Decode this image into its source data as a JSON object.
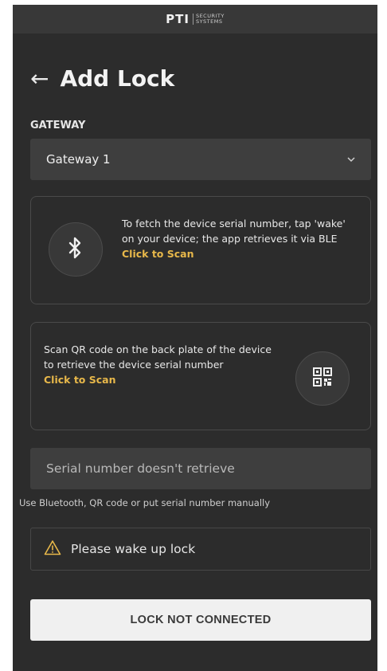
{
  "brand": {
    "mark": "PTI",
    "line1": "SECURITY",
    "line2": "SYSTEMS"
  },
  "header": {
    "back_icon": "arrow-left-icon",
    "title": "Add Lock"
  },
  "gateway": {
    "label": "GATEWAY",
    "selected": "Gateway 1",
    "chevron_icon": "chevron-down-icon"
  },
  "ble_card": {
    "icon": "bluetooth-icon",
    "description": "To fetch the device serial number, tap 'wake' on your device; the app retrieves it via BLE",
    "action": "Click to Scan"
  },
  "qr_card": {
    "icon": "qr-code-icon",
    "description": "Scan QR code on the back plate of the device to retrieve the device serial number",
    "action": "Click to Scan"
  },
  "serial": {
    "placeholder": "Serial number doesn't retrieve",
    "helper": "Use Bluetooth, QR code or put serial number manually"
  },
  "warning": {
    "icon": "warning-icon",
    "text": "Please wake up lock",
    "color": "#e8b84a"
  },
  "primary_button": {
    "label": "LOCK NOT CONNECTED"
  },
  "colors": {
    "background": "#2c2c2c",
    "surface": "#3e3e3e",
    "accent": "#e8b84a",
    "button": "#f0f0f0"
  }
}
